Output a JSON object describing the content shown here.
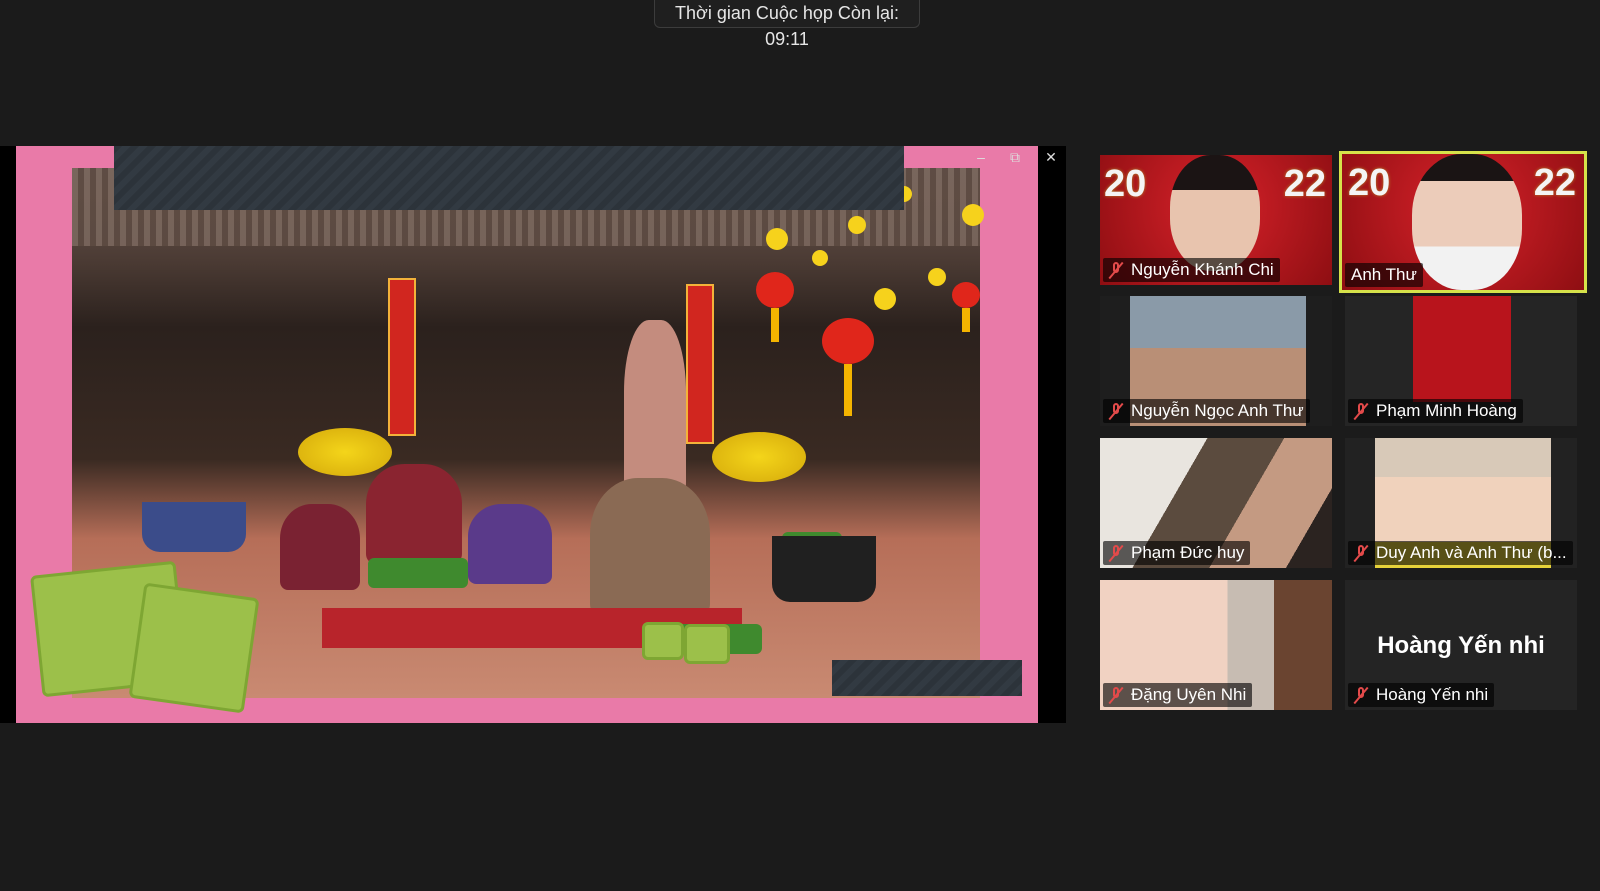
{
  "timer": {
    "text": "Thời gian Cuộc họp Còn lại: 09:11"
  },
  "share_window": {
    "controls": {
      "minimize": "–",
      "restore": "⧉",
      "close": "✕"
    }
  },
  "participants": [
    {
      "name": "Nguyễn Khánh Chi",
      "muted": true,
      "active": false,
      "year_left": "20",
      "year_right": "22"
    },
    {
      "name": "Anh Thư",
      "muted": false,
      "active": true,
      "year_left": "20",
      "year_right": "22"
    },
    {
      "name": "Nguyễn Ngọc Anh Thư",
      "muted": true,
      "active": false
    },
    {
      "name": "Phạm Minh Hoàng",
      "muted": true,
      "active": false
    },
    {
      "name": "Phạm Đức huy",
      "muted": true,
      "active": false
    },
    {
      "name": "Duy Anh và Anh Thư (b...",
      "muted": true,
      "active": false
    },
    {
      "name": "Đặng Uyên Nhi",
      "muted": true,
      "active": false
    },
    {
      "name": "Hoàng Yến nhi",
      "muted": true,
      "active": false,
      "display_name": "Hoàng Yến nhi"
    }
  ],
  "colors": {
    "active_border": "#d6e24a",
    "mic_muted": "#e34a4a",
    "slide_bg": "#e97aa8"
  }
}
